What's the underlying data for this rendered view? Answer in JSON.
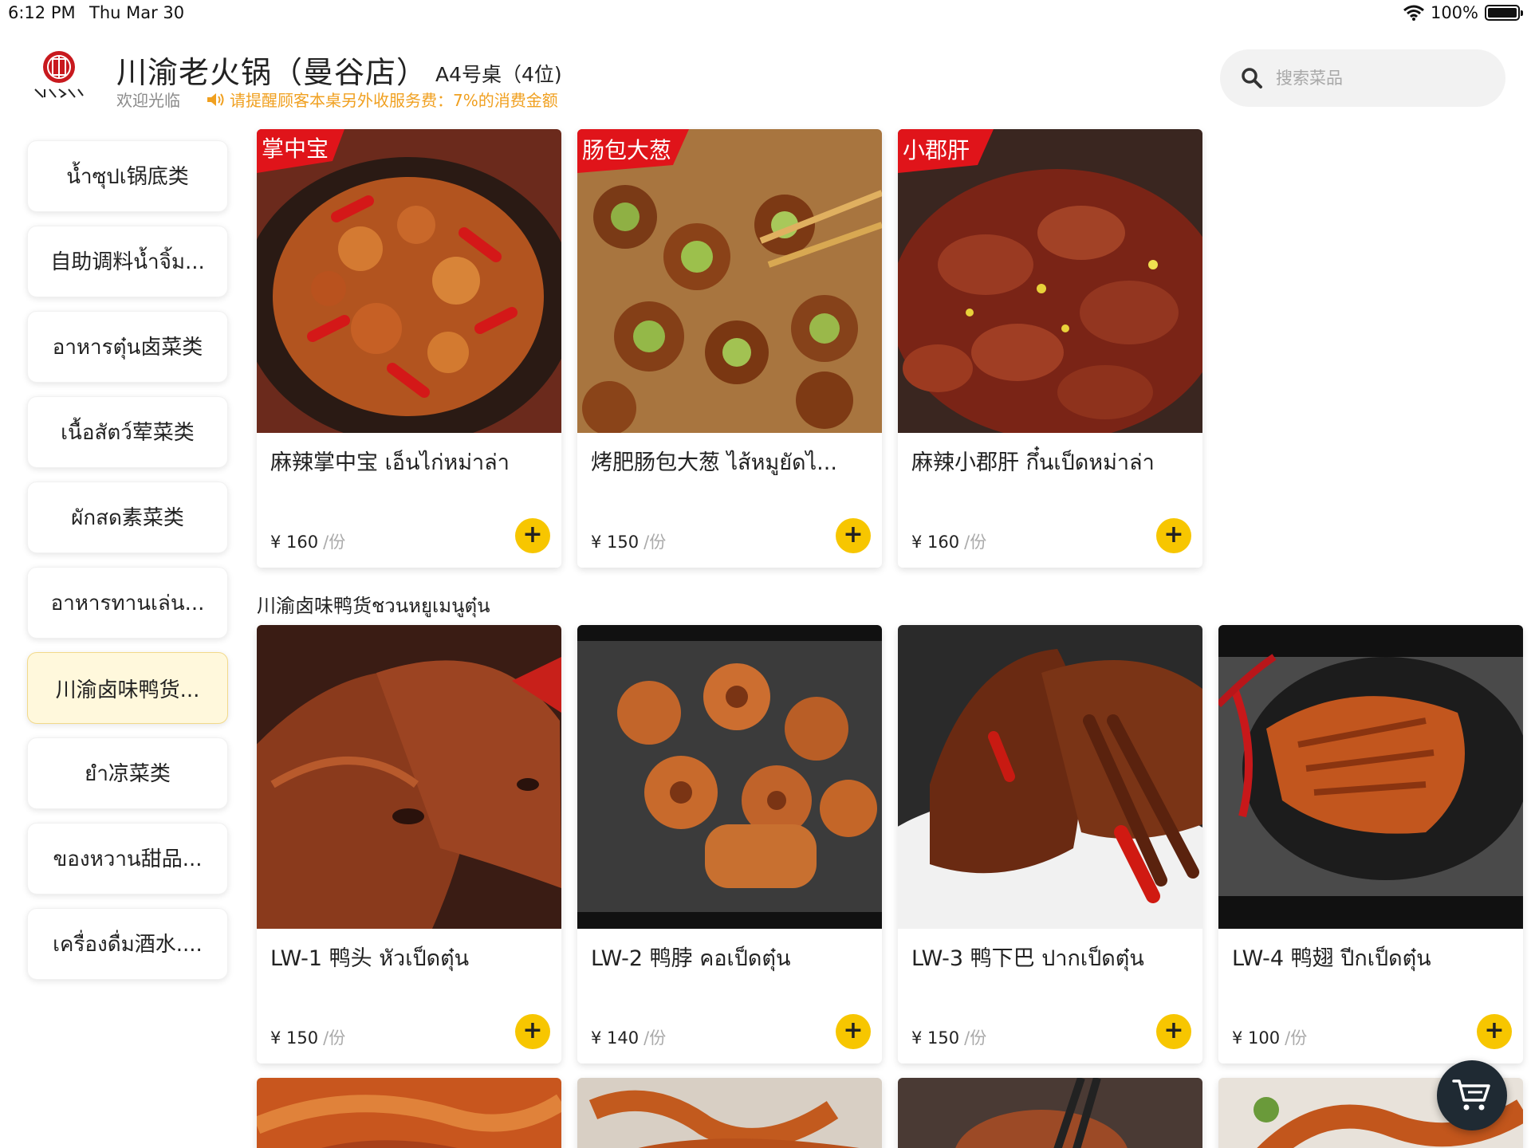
{
  "status_bar": {
    "time": "6:12 PM",
    "date": "Thu Mar 30",
    "battery": "100%"
  },
  "header": {
    "store_name": "川渝老火锅（曼谷店）",
    "table_info": "A4号桌（4位)",
    "welcome": "欢迎光临",
    "notice": "请提醒顾客本桌另外收服务费：7%的消费金额"
  },
  "search": {
    "placeholder": "搜索菜品"
  },
  "colors": {
    "accent": "#f7c600",
    "notice": "#f0a020",
    "active_category_bg": "#fff8dc",
    "cart_bg": "#1f2a33"
  },
  "categories": [
    {
      "label": "น้ำซุปเ锅底类",
      "active": false
    },
    {
      "label": "自助调料น้ำจิ้ม...",
      "active": false
    },
    {
      "label": "อาหารตุ๋น卤菜类",
      "active": false
    },
    {
      "label": "เนื้อสัตว์荤菜类",
      "active": false
    },
    {
      "label": "ผักสด素菜类",
      "active": false
    },
    {
      "label": "อาหารทานเล่น...",
      "active": false
    },
    {
      "label": "川渝卤味鸭货...",
      "active": true
    },
    {
      "label": "ยำ凉菜类",
      "active": false
    },
    {
      "label": "ของหวาน甜品...",
      "active": false
    },
    {
      "label": "เครื่องดื่ม酒水....",
      "active": false
    }
  ],
  "top_products": [
    {
      "name": "麻辣掌中宝 เอ็นไก่หม่าล่า",
      "price": "¥ 160",
      "unit": "/份",
      "banner": "掌中宝",
      "icon": "dish-photo"
    },
    {
      "name": "烤肥肠包大葱 ไส้หมูยัดไ...",
      "price": "¥ 150",
      "unit": "/份",
      "banner": "肠包大葱",
      "icon": "dish-photo"
    },
    {
      "name": "麻辣小郡肝 กึ๋นเป็ดหม่าล่า",
      "price": "¥ 160",
      "unit": "/份",
      "banner": "小郡肝",
      "icon": "dish-photo"
    }
  ],
  "section": {
    "title": "川渝卤味鸭货ชวนหยูเมนูตุ๋น"
  },
  "section_products": [
    {
      "name": "LW-1 鸭头 หัวเป็ดตุ๋น",
      "price": "¥ 150",
      "unit": "/份"
    },
    {
      "name": "LW-2 鸭脖 คอเป็ดตุ๋น",
      "price": "¥ 140",
      "unit": "/份"
    },
    {
      "name": "LW-3 鸭下巴 ปากเป็ดตุ๋น",
      "price": "¥ 150",
      "unit": "/份"
    },
    {
      "name": "LW-4 鸭翅 ปีกเป็ดตุ๋น",
      "price": "¥ 100",
      "unit": "/份"
    }
  ],
  "add_symbol": "+"
}
